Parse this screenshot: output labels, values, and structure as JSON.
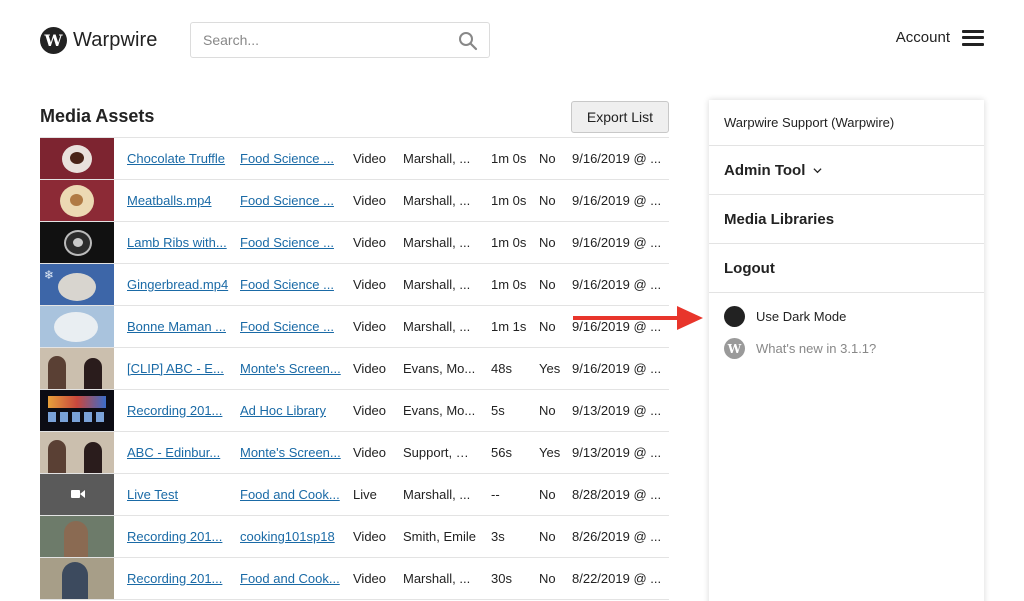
{
  "header": {
    "brand": "Warpwire",
    "logo_letter": "W",
    "search_placeholder": "Search...",
    "account_label": "Account"
  },
  "main": {
    "title": "Media Assets",
    "export_label": "Export List",
    "rows": [
      {
        "title": "Chocolate Truffle",
        "library": "Food Science ...",
        "type": "Video",
        "owner": "Marshall, ...",
        "duration": "1m 0s",
        "captions": "No",
        "date": "9/16/2019 @ ...",
        "thumb": "chocolate"
      },
      {
        "title": "Meatballs.mp4",
        "library": "Food Science ...",
        "type": "Video",
        "owner": "Marshall, ...",
        "duration": "1m 0s",
        "captions": "No",
        "date": "9/16/2019 @ ...",
        "thumb": "meatballs"
      },
      {
        "title": "Lamb Ribs with...",
        "library": "Food Science ...",
        "type": "Video",
        "owner": "Marshall, ...",
        "duration": "1m 0s",
        "captions": "No",
        "date": "9/16/2019 @ ...",
        "thumb": "lamb"
      },
      {
        "title": "Gingerbread.mp4",
        "library": "Food Science ...",
        "type": "Video",
        "owner": "Marshall, ...",
        "duration": "1m 0s",
        "captions": "No",
        "date": "9/16/2019 @ ...",
        "thumb": "gingerbread"
      },
      {
        "title": "Bonne Maman ...",
        "library": "Food Science ...",
        "type": "Video",
        "owner": "Marshall, ...",
        "duration": "1m 1s",
        "captions": "No",
        "date": "9/16/2019 @ ...",
        "thumb": "bonne"
      },
      {
        "title": "[CLIP] ABC - E...",
        "library": "Monte's Screen...",
        "type": "Video",
        "owner": "Evans, Mo...",
        "duration": "48s",
        "captions": "Yes",
        "date": "9/16/2019 @ ...",
        "thumb": "people"
      },
      {
        "title": "Recording 201...",
        "library": "Ad Hoc Library",
        "type": "Video",
        "owner": "Evans, Mo...",
        "duration": "5s",
        "captions": "No",
        "date": "9/13/2019 @ ...",
        "thumb": "screen"
      },
      {
        "title": "ABC - Edinbur...",
        "library": "Monte's Screen...",
        "type": "Video",
        "owner": "Support, W...",
        "duration": "56s",
        "captions": "Yes",
        "date": "9/13/2019 @ ...",
        "thumb": "people"
      },
      {
        "title": "Live Test",
        "library": "Food and Cook...",
        "type": "Live",
        "owner": "Marshall, ...",
        "duration": "--",
        "captions": "No",
        "date": "8/28/2019 @ ...",
        "thumb": "live"
      },
      {
        "title": "Recording 201...",
        "library": "cooking101sp18",
        "type": "Video",
        "owner": "Smith, Emile",
        "duration": "3s",
        "captions": "No",
        "date": "8/26/2019 @ ...",
        "thumb": "man1"
      },
      {
        "title": "Recording 201...",
        "library": "Food and Cook...",
        "type": "Video",
        "owner": "Marshall, ...",
        "duration": "30s",
        "captions": "No",
        "date": "8/22/2019 @ ...",
        "thumb": "man2"
      }
    ]
  },
  "panel": {
    "user": "Warpwire Support (Warpwire)",
    "admin_tool": "Admin Tool",
    "media_libraries": "Media Libraries",
    "logout": "Logout",
    "dark_mode": "Use Dark Mode",
    "whats_new": "What's new in 3.1.1?"
  },
  "colors": {
    "link": "#1a6aa6",
    "arrow": "#e8352b"
  }
}
